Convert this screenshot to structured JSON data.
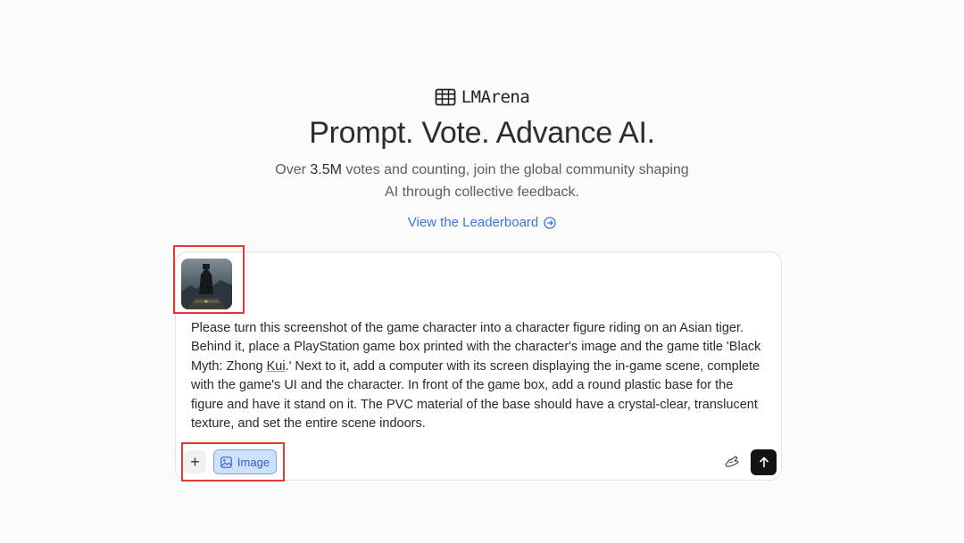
{
  "brand": {
    "name": "LMArena",
    "logo_icon": "grid-table-icon"
  },
  "hero": {
    "title": "Prompt. Vote. Advance AI.",
    "subtitle_prefix": "Over ",
    "subtitle_strong": "3.5M",
    "subtitle_suffix": " votes and counting, join the global community shaping AI through collective feedback."
  },
  "leaderboard_link": {
    "label": "View the Leaderboard",
    "icon": "arrow-right-circle-icon",
    "color": "#3b76d8"
  },
  "composer": {
    "attachment": {
      "icon": "image-thumbnail"
    },
    "prompt_parts": [
      "Please turn this screenshot of the game character into a character figure riding on an Asian tiger. Behind it, place a PlayStation game box printed with the character's image and the game title 'Black Myth: Zhong ",
      "Kui",
      ".' Next to it, add a computer with its screen displaying the in-game scene, complete with the game's UI and the character. In front of the game box, add a round plastic base for the figure and have it stand on it. The PVC material of the base should have a crystal-clear, translucent texture, and set the entire scene indoors."
    ],
    "toolbar": {
      "plus_label": "+",
      "image_label": "Image",
      "image_icon": "image-icon",
      "tool_icon": "hand-icon",
      "send_icon": "arrow-up-icon"
    }
  },
  "colors": {
    "background": "#fbfbfb",
    "highlight": "#e23a33",
    "image_button_bg": "#cfe0fb",
    "send_bg": "#131316"
  }
}
